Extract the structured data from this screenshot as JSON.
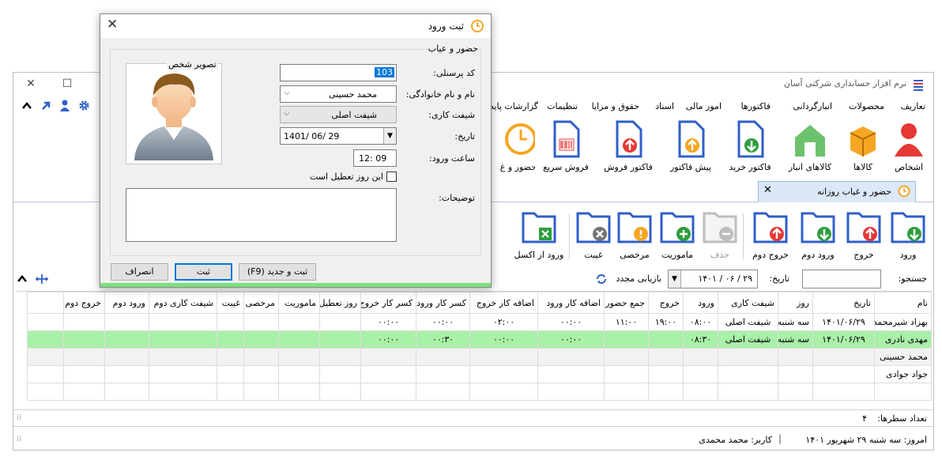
{
  "app": {
    "title": "نرم افزار حسابداری شرکتی آسان",
    "menu": [
      "تعاریف",
      "محصولات",
      "انبارگردانی",
      "فاکتورها",
      "امور مالی",
      "اسناد",
      "حقوق و مزایا",
      "تنظیمات",
      "گزارشات پایه"
    ],
    "ribbon": [
      "اشخاص",
      "کالاها",
      "کالاهای انبار",
      "فاکتور خرید",
      "پیش فاکتور",
      "فاکتور فروش",
      "فروش سریع",
      "حضور و غ"
    ]
  },
  "tab": {
    "label": "حضور و غیاب روزانه"
  },
  "toolbar": {
    "buttons": [
      "ورود",
      "خروج",
      "ورود دوم",
      "خروج دوم",
      "حذف",
      "ماموریت",
      "مرخصی",
      "غیبت",
      "ورود از اکسل"
    ]
  },
  "search": {
    "search_label": "جستجو:",
    "search_value": "",
    "date_label": "تاریخ:",
    "date_value": "۱۴۰۱ / ۰۶ / ۲۹",
    "refresh_label": "بازیابی مجدد"
  },
  "grid": {
    "columns": [
      "نام",
      "تاریخ",
      "روز",
      "شیفت کاری",
      "ورود",
      "خروج",
      "جمع حضور",
      "اضافه کار ورود",
      "اضافه کار خروج",
      "کسر کار ورود",
      "کسر کار خروج",
      "روز تعطیل",
      "ماموریت",
      "مرخصی",
      "غیبت",
      "شیفت کاری دوم",
      "ورود دوم",
      "خروج دوم"
    ],
    "rows": [
      [
        "بهزاد شیرمحمدی",
        "۱۴۰۱/۰۶/۲۹",
        "سه شنبه",
        "شیفت اصلی",
        "۰۸:۰۰",
        "۱۹:۰۰",
        "۱۱:۰۰",
        "۰۰:۰۰",
        "۰۲:۰۰",
        "۰۰:۰۰",
        "۰۰:۰۰",
        "",
        "",
        "",
        "",
        "",
        "",
        ""
      ],
      [
        "مهدی نادری",
        "۱۴۰۱/۰۶/۲۹",
        "سه شنبه",
        "شیفت اصلی",
        "۰۸:۳۰",
        "",
        "",
        "۰۰:۰۰",
        "۰۰:۰۰",
        "۰۰:۳۰",
        "۰۰:۰۰",
        "",
        "",
        "",
        "",
        "",
        "",
        ""
      ],
      [
        "محمد حسینی",
        "",
        "",
        "",
        "",
        "",
        "",
        "",
        "",
        "",
        "",
        "",
        "",
        "",
        "",
        "",
        "",
        ""
      ],
      [
        "جواد جوادی",
        "",
        "",
        "",
        "",
        "",
        "",
        "",
        "",
        "",
        "",
        "",
        "",
        "",
        "",
        "",
        "",
        ""
      ]
    ]
  },
  "status": {
    "row_count_label": "تعداد سطرها:",
    "row_count": "۴",
    "today": "امروز: سه شنبه ۲۹ شهریور ۱۴۰۱",
    "user": "کاربر: محمد محمدی"
  },
  "dialog": {
    "title": "ثبت ورود",
    "legend": "حضور و عیاب",
    "photo_label": "تصویر شخص",
    "code_label": "کد پرسنلی:",
    "code_value": "103",
    "name_label": "نام و نام خانوادگی:",
    "name_value": "محمد حسینی",
    "shift_label": "شیفت کاری:",
    "shift_value": "شیفت اصلی",
    "date_label": "تاریخ:",
    "date_value": "1401/ 06/ 29",
    "time_label": "ساعت ورود:",
    "time_value": "12: 09",
    "holiday_label": "این روز تعطیل است",
    "notes_label": "توضیحات:",
    "btn_save_new": "ثبت و جدید (F9)",
    "btn_save": "ثبت",
    "btn_cancel": "انصراف"
  },
  "colors": {
    "accent": "#2f5fc9",
    "selected_row": "#a9f0a9",
    "orange": "#f39c12",
    "green": "#2e9e3e",
    "red": "#e53935"
  }
}
